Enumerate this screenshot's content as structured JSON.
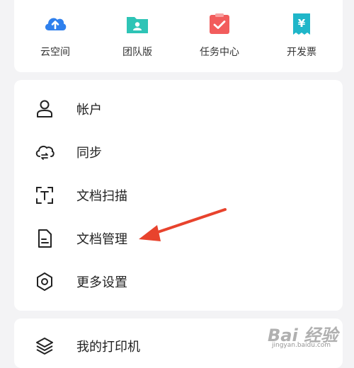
{
  "quick_actions": [
    {
      "label": "云空间",
      "icon": "cloud-upload-icon",
      "color": "#2f80ed"
    },
    {
      "label": "团队版",
      "icon": "team-folder-icon",
      "color": "#2ec4b6"
    },
    {
      "label": "任务中心",
      "icon": "task-check-icon",
      "color": "#f25c5c"
    },
    {
      "label": "开发票",
      "icon": "invoice-receipt-icon",
      "color": "#1fb6c9"
    }
  ],
  "menu": [
    {
      "label": "帐户",
      "icon": "user-icon"
    },
    {
      "label": "同步",
      "icon": "cloud-sync-icon"
    },
    {
      "label": "文档扫描",
      "icon": "text-scan-icon"
    },
    {
      "label": "文档管理",
      "icon": "document-icon"
    },
    {
      "label": "更多设置",
      "icon": "settings-gear-icon"
    }
  ],
  "bottom_menu": [
    {
      "label": "我的打印机",
      "icon": "layers-icon"
    }
  ],
  "invoice_symbol": "¥",
  "watermark": {
    "main": "Bai 经验",
    "sub": "jingyan.baidu.com"
  },
  "arrow_color": "#e8432d"
}
